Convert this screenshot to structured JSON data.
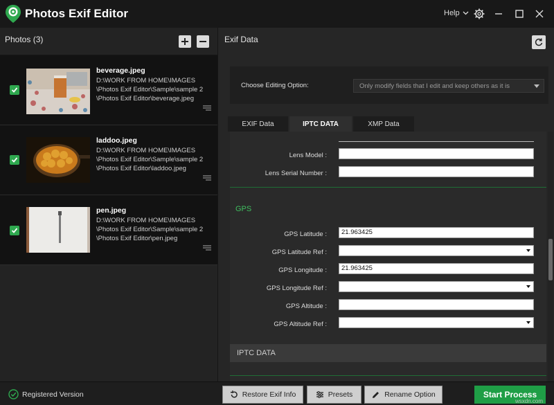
{
  "app": {
    "title": "Photos Exif Editor",
    "help_label": "Help"
  },
  "left_panel": {
    "title": "Photos (3)",
    "photos": [
      {
        "name": "beverage.jpeg",
        "path": "D:\\WORK FROM HOME\\IMAGES\n\\Photos Exif Editor\\Sample\\sample 2\n\\Photos Exif Editor\\beverage.jpeg"
      },
      {
        "name": "laddoo.jpeg",
        "path": "D:\\WORK FROM HOME\\IMAGES\n\\Photos Exif Editor\\Sample\\sample 2\n\\Photos Exif Editor\\laddoo.jpeg"
      },
      {
        "name": "pen.jpeg",
        "path": "D:\\WORK FROM HOME\\IMAGES\n\\Photos Exif Editor\\Sample\\sample 2\n\\Photos Exif Editor\\pen.jpeg"
      }
    ]
  },
  "right_panel": {
    "title": "Exif Data",
    "editing_option_label": "Choose Editing Option:",
    "editing_option_value": "Only modify fields that I edit and keep others as it is",
    "tabs": [
      "EXIF Data",
      "IPTC DATA",
      "XMP Data"
    ],
    "active_tab": "IPTC DATA",
    "fields": {
      "lens_model": {
        "label": "Lens Model :",
        "value": ""
      },
      "lens_serial": {
        "label": "Lens Serial Number :",
        "value": ""
      },
      "gps_latitude": {
        "label": "GPS Latitude :",
        "value": "21.963425"
      },
      "gps_latitude_ref": {
        "label": "GPS Latitude Ref :",
        "value": ""
      },
      "gps_longitude": {
        "label": "GPS Longitude :",
        "value": "21.963425"
      },
      "gps_longitude_ref": {
        "label": "GPS Longitude Ref :",
        "value": ""
      },
      "gps_altitude": {
        "label": "GPS Altitude :",
        "value": ""
      },
      "gps_altitude_ref": {
        "label": "GPS Altitude Ref :",
        "value": ""
      }
    },
    "gps_heading": "GPS",
    "iptc_heading": "IPTC DATA"
  },
  "bottom_bar": {
    "registered_label": "Registered Version",
    "restore_label": "Restore Exif Info",
    "presets_label": "Presets",
    "rename_label": "Rename Option",
    "start_label": "Start Process"
  },
  "watermark": "wsxdn.com",
  "colors": {
    "accent_green": "#1f9e46",
    "checkbox_green": "#2fa84f",
    "gps_heading": "#3fbf5f"
  }
}
